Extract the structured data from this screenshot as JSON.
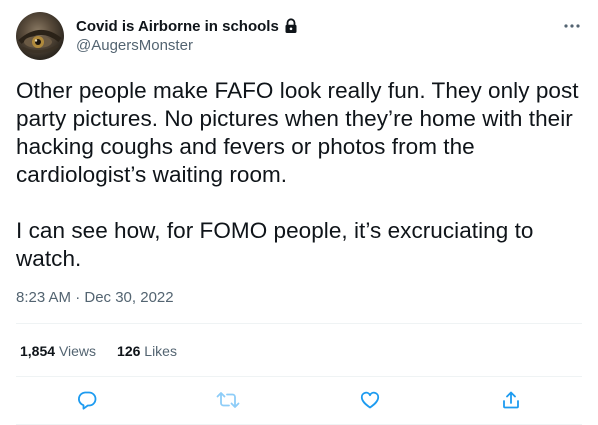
{
  "author": {
    "display_name": "Covid is Airborne in schools",
    "handle": "@AugersMonster",
    "protected": true
  },
  "tweet": {
    "text": "Other people make FAFO look really fun. They only post party pictures. No pictures when they’re home with their hacking coughs and fevers or photos from the cardiologist’s waiting room.\n\nI can see how, for FOMO people, it’s excruciating to watch.",
    "timestamp": "8:23 AM · Dec 30, 2022"
  },
  "stats": {
    "views_count": "1,854",
    "views_label": "Views",
    "likes_count": "126",
    "likes_label": "Likes"
  },
  "icons": {
    "more": "more-horizontal-icon",
    "lock": "lock-icon",
    "reply": "reply-icon",
    "retweet": "retweet-icon",
    "like": "heart-icon",
    "share": "share-icon"
  },
  "colors": {
    "text_primary": "#0f1419",
    "text_secondary": "#536471",
    "divider": "#eff3f4",
    "icon_active": "#1d9bf0",
    "icon_disabled": "#8ecdf8"
  }
}
